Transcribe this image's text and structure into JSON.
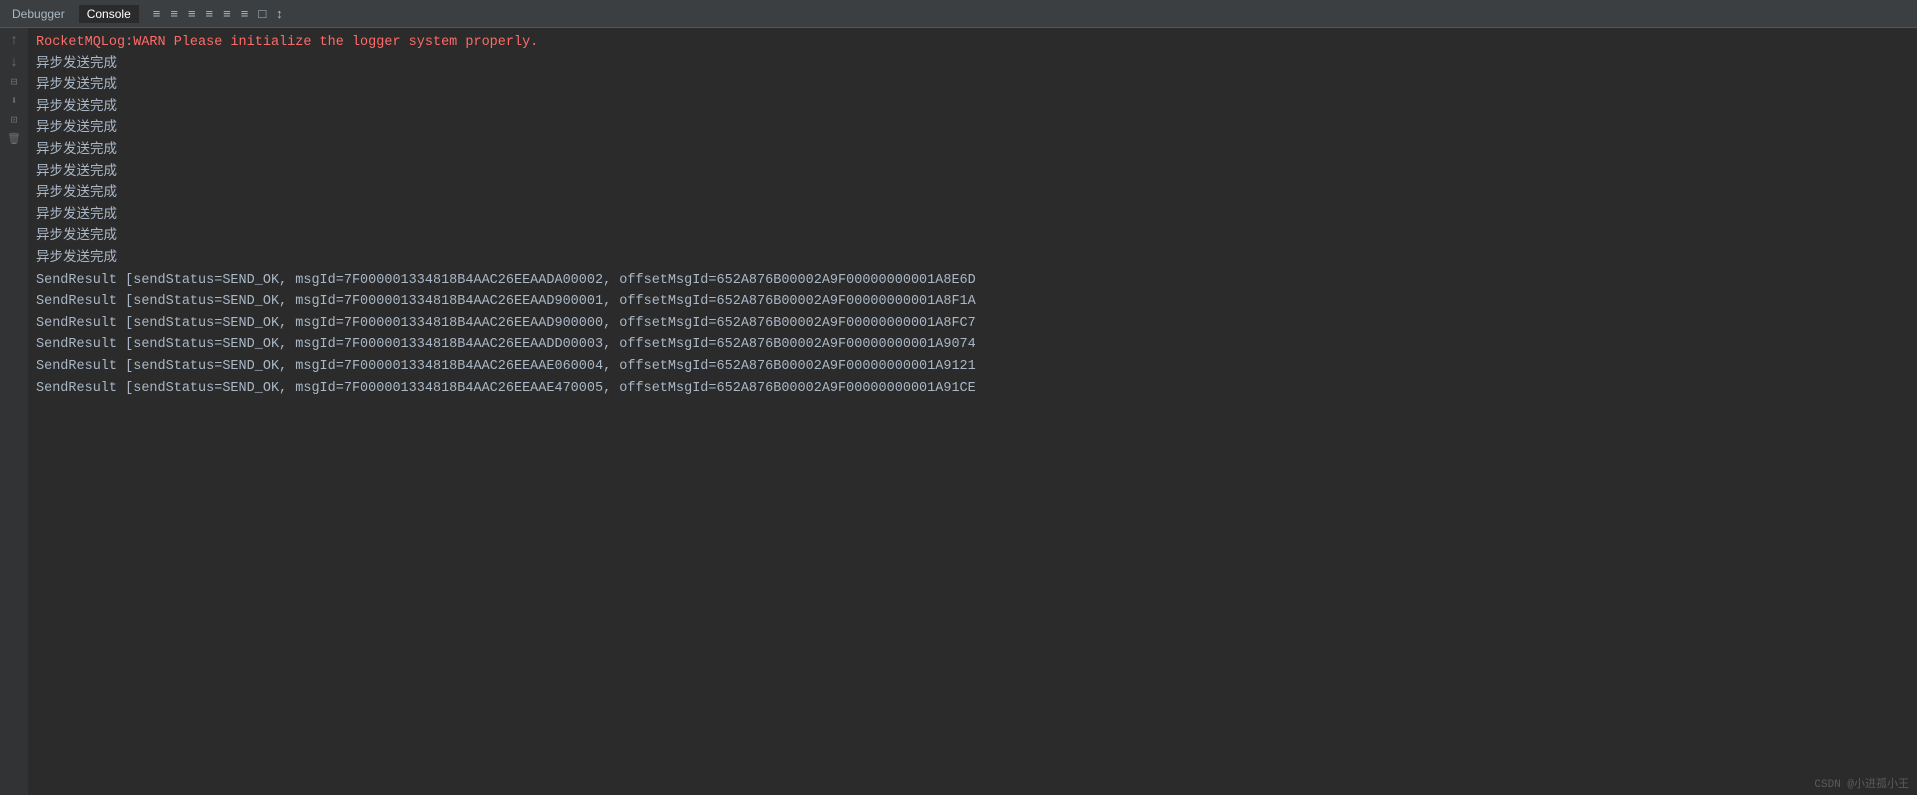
{
  "toolbar": {
    "tabs": [
      {
        "label": "Debugger",
        "active": false
      },
      {
        "label": "Console",
        "active": true
      }
    ],
    "icons": [
      "≡",
      "≡",
      "≡",
      "≡",
      "≡",
      "≡",
      "□",
      "↕"
    ]
  },
  "gutter": {
    "icons": [
      "↑",
      "↓",
      "⊟",
      "⬇",
      "🖨",
      "🗑"
    ]
  },
  "logs": [
    {
      "type": "warn",
      "text": "RocketMQLog:WARN Please initialize the logger system properly."
    },
    {
      "type": "normal",
      "text": "异步发送完成"
    },
    {
      "type": "normal",
      "text": "异步发送完成"
    },
    {
      "type": "normal",
      "text": "异步发送完成"
    },
    {
      "type": "normal",
      "text": "异步发送完成"
    },
    {
      "type": "normal",
      "text": "异步发送完成"
    },
    {
      "type": "normal",
      "text": "异步发送完成"
    },
    {
      "type": "normal",
      "text": "异步发送完成"
    },
    {
      "type": "normal",
      "text": "异步发送完成"
    },
    {
      "type": "normal",
      "text": "异步发送完成"
    },
    {
      "type": "normal",
      "text": "异步发送完成"
    },
    {
      "type": "send-result",
      "text": "SendResult [sendStatus=SEND_OK, msgId=7F000001334818B4AAC26EEAADA00002, offsetMsgId=652A876B00002A9F00000000001A8E6D"
    },
    {
      "type": "send-result",
      "text": "SendResult [sendStatus=SEND_OK, msgId=7F000001334818B4AAC26EEAAD900001, offsetMsgId=652A876B00002A9F00000000001A8F1A"
    },
    {
      "type": "send-result",
      "text": "SendResult [sendStatus=SEND_OK, msgId=7F000001334818B4AAC26EEAAD900000, offsetMsgId=652A876B00002A9F00000000001A8FC7"
    },
    {
      "type": "send-result",
      "text": "SendResult [sendStatus=SEND_OK, msgId=7F000001334818B4AAC26EEAADD00003, offsetMsgId=652A876B00002A9F00000000001A9074"
    },
    {
      "type": "send-result",
      "text": "SendResult [sendStatus=SEND_OK, msgId=7F000001334818B4AAC26EEAAE060004, offsetMsgId=652A876B00002A9F00000000001A9121"
    },
    {
      "type": "send-result",
      "text": "SendResult [sendStatus=SEND_OK, msgId=7F000001334818B4AAC26EEAAE470005, offsetMsgId=652A876B00002A9F00000000001A91CE"
    }
  ],
  "watermark": {
    "text": "CSDN @小进孤小王"
  }
}
